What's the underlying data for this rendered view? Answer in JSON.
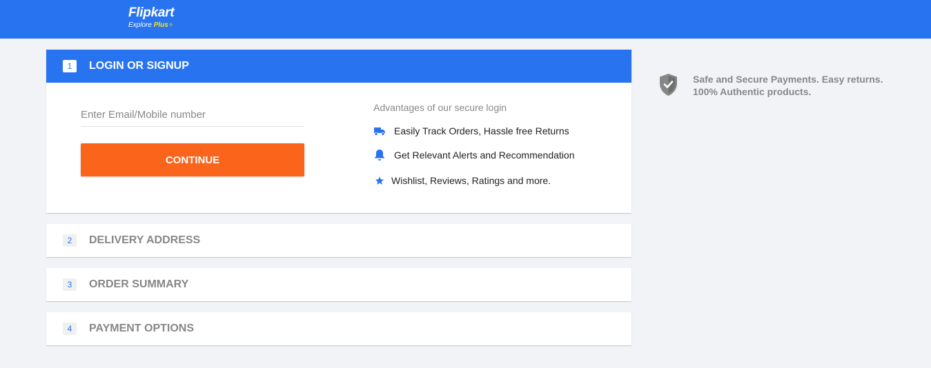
{
  "header": {
    "logo_word": "Flipkart",
    "logo_explore": "Explore",
    "logo_plus": "Plus",
    "brand_color": "#2874f0",
    "plus_color": "#ffe500"
  },
  "steps": [
    {
      "number": "1",
      "title": "LOGIN OR SIGNUP",
      "active": true
    },
    {
      "number": "2",
      "title": "DELIVERY ADDRESS",
      "active": false
    },
    {
      "number": "3",
      "title": "ORDER SUMMARY",
      "active": false
    },
    {
      "number": "4",
      "title": "PAYMENT OPTIONS",
      "active": false
    }
  ],
  "login": {
    "input_placeholder": "Enter Email/Mobile number",
    "input_value": "",
    "continue_label": "CONTINUE",
    "continue_color": "#fb641b",
    "advantages_title": "Advantages of our secure login",
    "advantages": [
      {
        "icon": "truck-icon",
        "text": "Easily Track Orders, Hassle free Returns"
      },
      {
        "icon": "bell-icon",
        "text": "Get Relevant Alerts and Recommendation"
      },
      {
        "icon": "star-icon",
        "text": "Wishlist, Reviews, Ratings and more."
      }
    ]
  },
  "safety": {
    "icon": "shield-check-icon",
    "line1": "Safe and Secure Payments. Easy returns.",
    "line2": "100% Authentic products."
  }
}
